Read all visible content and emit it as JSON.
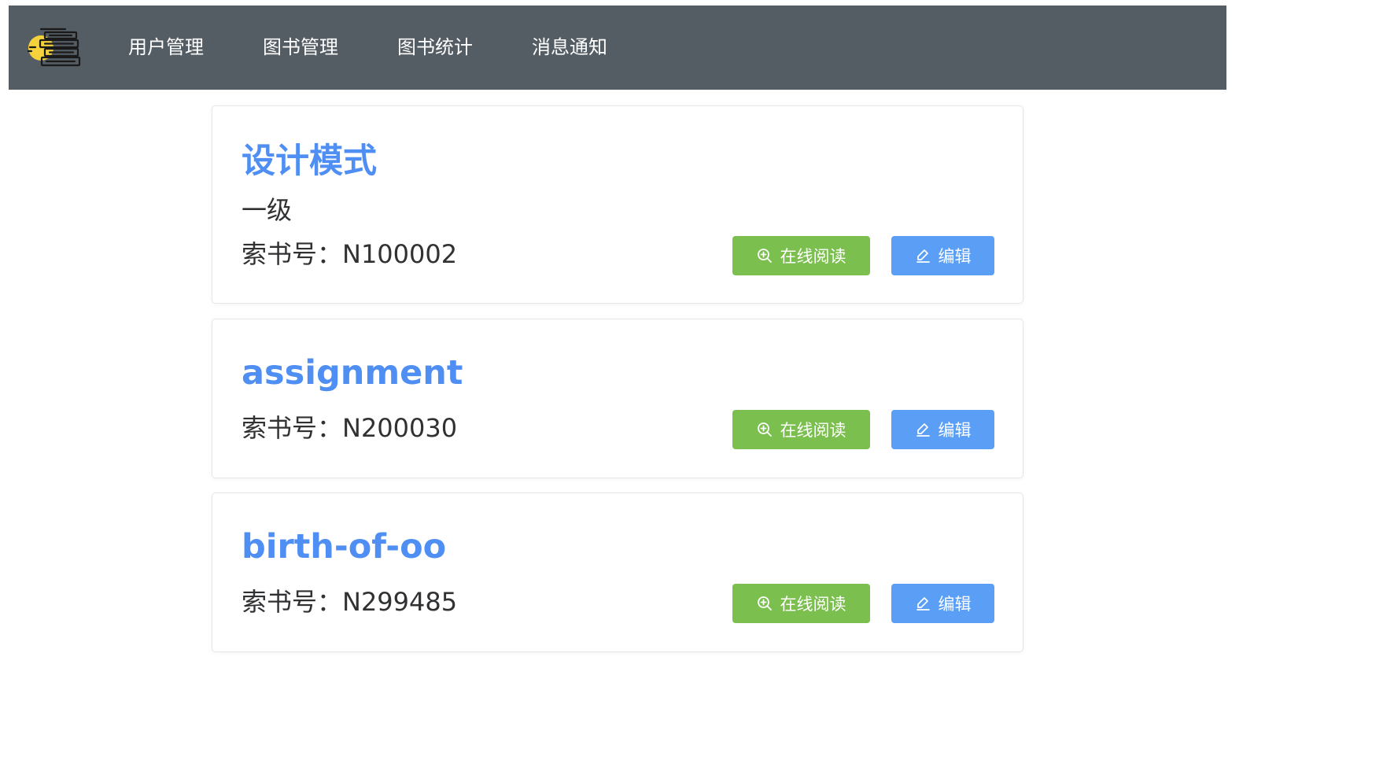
{
  "nav": {
    "logo_icon": "book-stack-logo-icon",
    "items": [
      {
        "label": "用户管理"
      },
      {
        "label": "图书管理"
      },
      {
        "label": "图书统计"
      },
      {
        "label": "消息通知"
      }
    ]
  },
  "books": [
    {
      "title": "设计模式",
      "level": "一级",
      "code": "索书号：N100002",
      "read_label": "在线阅读",
      "edit_label": "编辑"
    },
    {
      "title": "assignment",
      "code": "索书号：N200030",
      "read_label": "在线阅读",
      "edit_label": "编辑"
    },
    {
      "title": "birth-of-oo",
      "code": "索书号：N299485",
      "read_label": "在线阅读",
      "edit_label": "编辑"
    }
  ],
  "colors": {
    "nav_bg": "#545c64",
    "title": "#4f8ef2",
    "read_button": "#7bbf4e",
    "edit_button": "#5a9ef5"
  }
}
